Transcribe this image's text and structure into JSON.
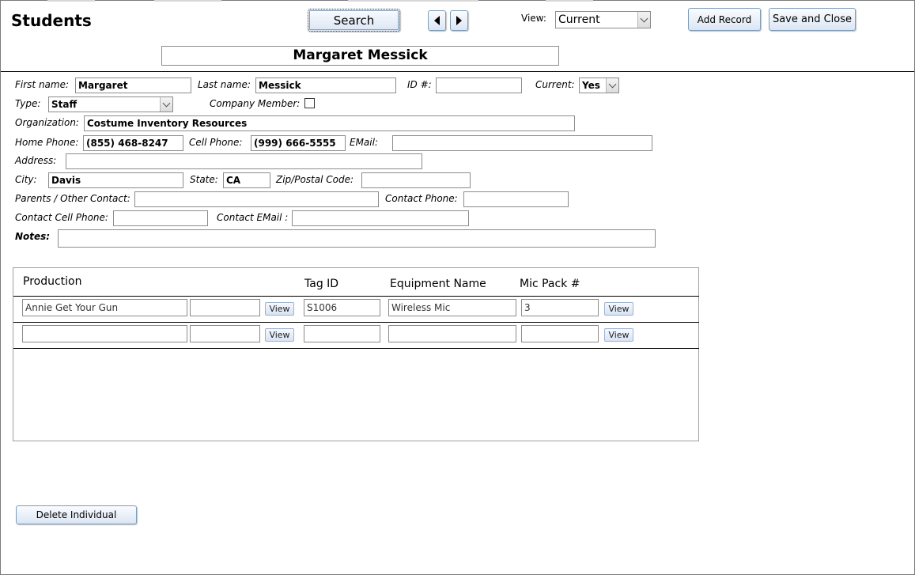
{
  "form": {
    "title": "Students",
    "record_name": "Margaret Messick"
  },
  "toolbar": {
    "search_label": "Search",
    "view_label": "View:",
    "view_value": "Current",
    "add_record_label": "Add Record",
    "save_close_label": "Save and Close"
  },
  "fields": {
    "first_name": {
      "label": "First name:",
      "value": "Margaret"
    },
    "last_name": {
      "label": "Last name:",
      "value": "Messick"
    },
    "id": {
      "label": "ID #:",
      "value": ""
    },
    "current": {
      "label": "Current:",
      "value": "Yes"
    },
    "type": {
      "label": "Type:",
      "value": "Staff"
    },
    "company_member": {
      "label": "Company Member:",
      "checked": false
    },
    "organization": {
      "label": "Organization:",
      "value": "Costume Inventory Resources"
    },
    "home_phone": {
      "label": "Home Phone:",
      "value": "(855) 468-8247"
    },
    "cell_phone": {
      "label": "Cell Phone:",
      "value": "(999) 666-5555"
    },
    "email": {
      "label": "EMail:",
      "value": ""
    },
    "address": {
      "label": "Address:",
      "value": ""
    },
    "city": {
      "label": "City:",
      "value": "Davis"
    },
    "state": {
      "label": "State:",
      "value": "CA"
    },
    "zip": {
      "label": "Zip/Postal Code:",
      "value": ""
    },
    "parents_contact": {
      "label": "Parents / Other Contact:",
      "value": ""
    },
    "contact_phone": {
      "label": "Contact Phone:",
      "value": ""
    },
    "contact_cell_phone": {
      "label": "Contact Cell Phone:",
      "value": ""
    },
    "contact_email": {
      "label": "Contact EMail :",
      "value": ""
    },
    "notes": {
      "label": "Notes:",
      "value": ""
    }
  },
  "subform": {
    "headers": {
      "production": "Production",
      "tag_id": "Tag ID",
      "equipment_name": "Equipment Name",
      "mic_pack": "Mic Pack #"
    },
    "view_label": "View",
    "rows": [
      {
        "production": "Annie Get Your Gun",
        "extra": "",
        "tag_id": "S1006",
        "equipment_name": "Wireless Mic",
        "mic_pack": "3"
      },
      {
        "production": "",
        "extra": "",
        "tag_id": "",
        "equipment_name": "",
        "mic_pack": ""
      }
    ]
  },
  "footer": {
    "delete_label": "Delete Individual"
  }
}
